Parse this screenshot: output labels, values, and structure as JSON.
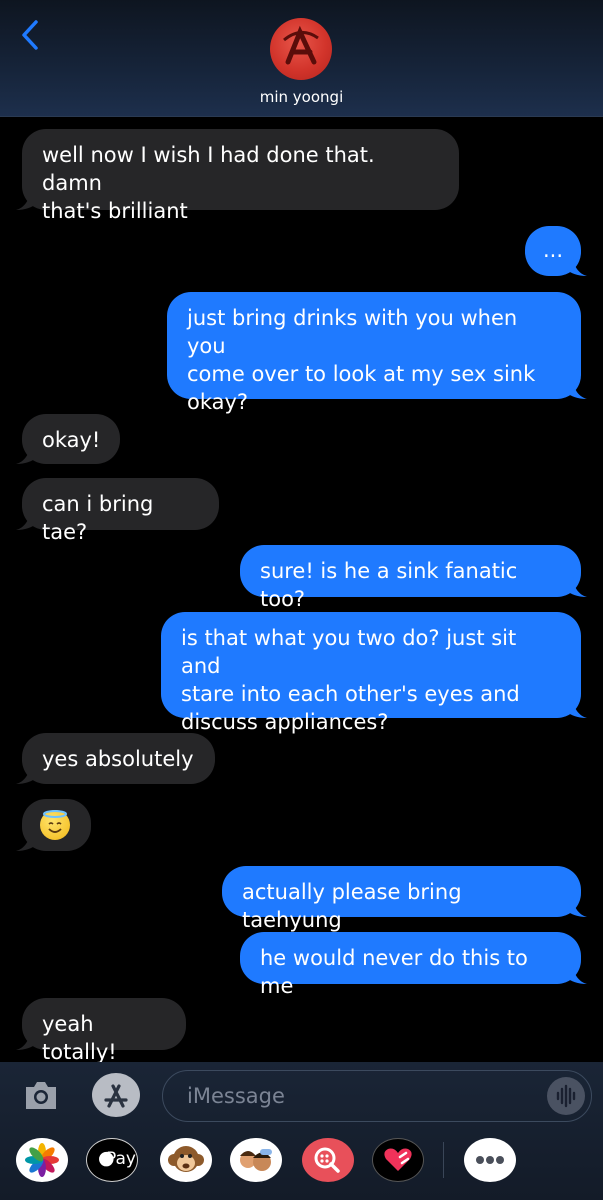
{
  "header": {
    "contact_name": "min yoongi",
    "back_icon": "chevron-left-icon"
  },
  "messages": [
    {
      "side": "in",
      "lines": [
        "well now I wish I had done that. damn",
        "that's brilliant"
      ]
    },
    {
      "side": "out",
      "lines": [
        "..."
      ]
    },
    {
      "side": "out",
      "lines": [
        "just bring drinks with you when you",
        "come over to look at my sex sink",
        "okay?"
      ]
    },
    {
      "side": "in",
      "lines": [
        "okay!"
      ]
    },
    {
      "side": "in",
      "lines": [
        "can i bring tae?"
      ]
    },
    {
      "side": "out",
      "lines": [
        "sure! is he a sink fanatic too?"
      ]
    },
    {
      "side": "out",
      "lines": [
        "is that what you two do? just sit and",
        "stare into each other's eyes and",
        "discuss appliances?"
      ]
    },
    {
      "side": "in",
      "lines": [
        "yes absolutely"
      ]
    },
    {
      "side": "in",
      "emoji": "halo-smiling-face"
    },
    {
      "side": "out",
      "lines": [
        "actually please bring taehyung"
      ]
    },
    {
      "side": "out",
      "lines": [
        "he would never do this to me"
      ]
    },
    {
      "side": "in",
      "lines": [
        "yeah totally!"
      ]
    }
  ],
  "input": {
    "placeholder": "iMessage"
  },
  "app_drawer": {
    "apple_pay_label": "Pay",
    "apps": [
      "photos-icon",
      "apple-pay-icon",
      "monkey-memoji-icon",
      "memoji-faces-icon",
      "image-search-icon",
      "digital-touch-heart-icon",
      "more-icon"
    ]
  },
  "colors": {
    "outgoing": "#1f7aff",
    "incoming": "#262628",
    "background": "#000000"
  }
}
